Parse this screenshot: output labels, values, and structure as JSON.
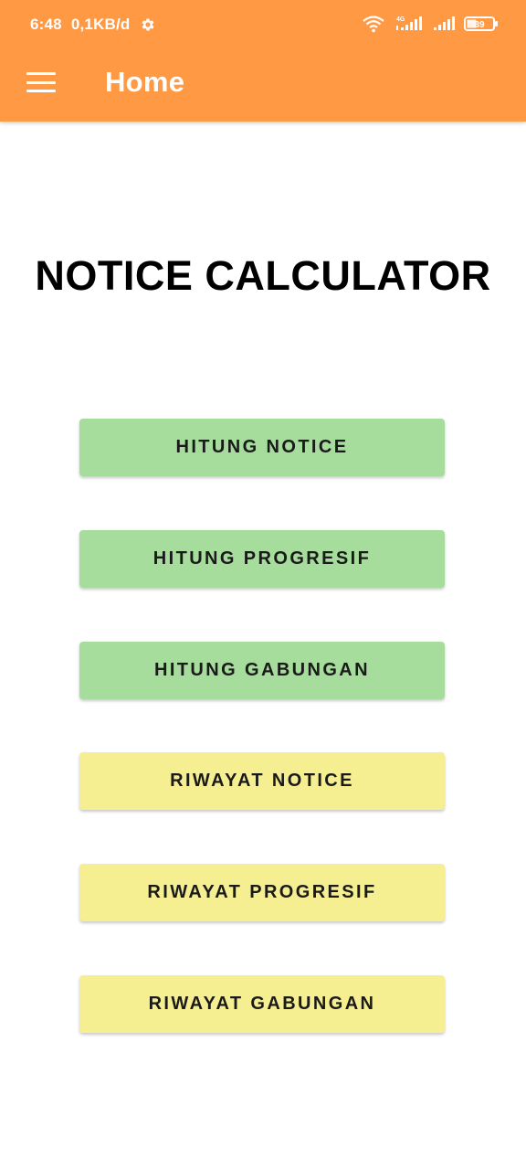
{
  "status_bar": {
    "time": "6:48",
    "data_speed": "0,1KB/d",
    "network_label": "4G",
    "battery": "39"
  },
  "toolbar": {
    "menu_icon": "hamburger-menu-icon",
    "title": "Home"
  },
  "main": {
    "title": "NOTICE CALCULATOR",
    "buttons": [
      {
        "label": "HITUNG NOTICE",
        "color": "#A6DD9C"
      },
      {
        "label": "HITUNG PROGRESIF",
        "color": "#A6DD9C"
      },
      {
        "label": "HITUNG GABUNGAN",
        "color": "#A6DD9C"
      },
      {
        "label": "RIWAYAT NOTICE",
        "color": "#F6EF92"
      },
      {
        "label": "RIWAYAT PROGRESIF",
        "color": "#F6EF92"
      },
      {
        "label": "RIWAYAT GABUNGAN",
        "color": "#F6EF92"
      }
    ]
  },
  "colors": {
    "appbar": "#FF9944",
    "background": "#FFFFFF"
  }
}
